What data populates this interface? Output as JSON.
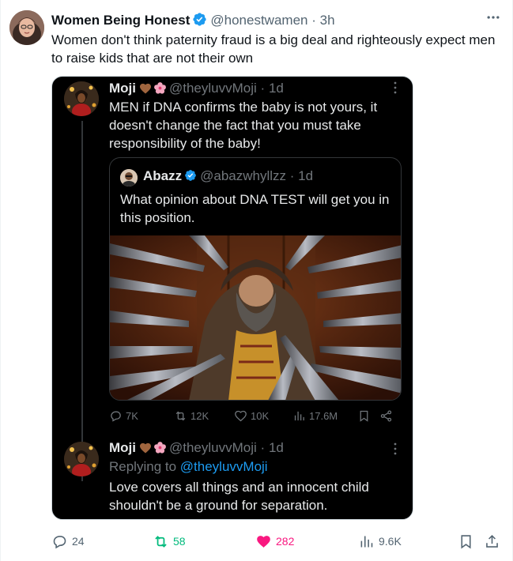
{
  "post": {
    "author_name": "Women Being Honest",
    "handle": "@honestwamen",
    "separator": "·",
    "time": "3h",
    "text": "Women don't think paternity fraud is a big deal and righteously expect men to raise kids that are not their own",
    "more_icon": "more-horizontal-icon",
    "accent_color": "#1d9bf0"
  },
  "embedded": {
    "first_post": {
      "author_name": "Moji",
      "handle": "@theyluvvMoji",
      "separator": "·",
      "time": "1d",
      "text": "MEN if DNA confirms the baby is not yours, it doesn't change the fact that you must take responsibility of the baby!"
    },
    "quote": {
      "author_name": "Abazz",
      "handle": "@abazwhyllzz",
      "separator": "·",
      "time": "1d",
      "text": "What opinion about DNA TEST will get you in this position."
    },
    "first_post_stats": {
      "replies": "7K",
      "reposts": "12K",
      "likes": "10K",
      "views": "17.6M"
    },
    "reply": {
      "author_name": "Moji",
      "handle": "@theyluvvMoji",
      "separator": "·",
      "time": "1d",
      "replying_prefix": "Replying to",
      "replying_to": "@theyluvvMoji",
      "text": "Love covers all things and an innocent child shouldn't be a ground for separation."
    }
  },
  "stats": {
    "replies": "24",
    "reposts": "58",
    "likes": "282",
    "views": "9.6K"
  }
}
